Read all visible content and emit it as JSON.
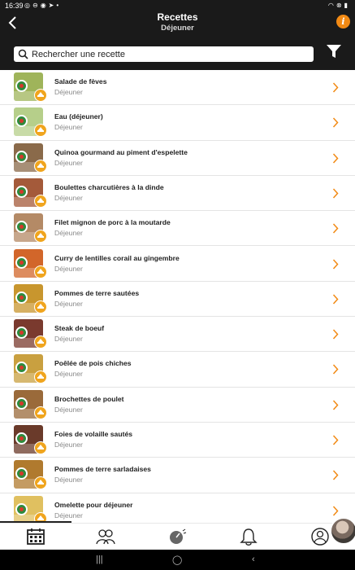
{
  "status_bar": {
    "time": "16:39",
    "left_icons": [
      "whatsapp-icon",
      "notification-icon",
      "messenger-icon",
      "telegram-icon",
      "dot-icon"
    ],
    "right_icons": [
      "wifi-icon",
      "mute-icon",
      "battery-icon"
    ]
  },
  "header": {
    "title": "Recettes",
    "subtitle": "Déjeuner"
  },
  "search": {
    "placeholder": "Rechercher une recette"
  },
  "recipes": [
    {
      "name": "Salade de fèves",
      "category": "Déjeuner",
      "tint": "#9fb45a"
    },
    {
      "name": "Eau (déjeuner)",
      "category": "Déjeuner",
      "tint": "#b6cf8a"
    },
    {
      "name": "Quinoa gourmand au piment d'espelette",
      "category": "Déjeuner",
      "tint": "#8a6a4a"
    },
    {
      "name": "Boulettes charcutières à la dinde",
      "category": "Déjeuner",
      "tint": "#a45a3a"
    },
    {
      "name": "Filet mignon de porc à la moutarde",
      "category": "Déjeuner",
      "tint": "#b48a66"
    },
    {
      "name": "Curry de lentilles corail au gingembre",
      "category": "Déjeuner",
      "tint": "#d2662a"
    },
    {
      "name": "Pommes de terre sautées",
      "category": "Déjeuner",
      "tint": "#c8962e"
    },
    {
      "name": "Steak de boeuf",
      "category": "Déjeuner",
      "tint": "#7a3a2e"
    },
    {
      "name": "Poêlée de pois chiches",
      "category": "Déjeuner",
      "tint": "#c9a040"
    },
    {
      "name": "Brochettes de poulet",
      "category": "Déjeuner",
      "tint": "#9a6a3a"
    },
    {
      "name": "Foies de volaille sautés",
      "category": "Déjeuner",
      "tint": "#6a3a2a"
    },
    {
      "name": "Pommes de terre sarladaises",
      "category": "Déjeuner",
      "tint": "#b07a2e"
    },
    {
      "name": "Omelette pour déjeuner",
      "category": "Déjeuner",
      "tint": "#e0c060"
    }
  ],
  "tabs": [
    {
      "icon": "calendar-icon"
    },
    {
      "icon": "community-icon"
    },
    {
      "icon": "scale-icon"
    },
    {
      "icon": "bell-icon"
    },
    {
      "icon": "profile-icon"
    }
  ],
  "colors": {
    "accent": "#f28a14",
    "header_bg": "#1a1a1a"
  }
}
